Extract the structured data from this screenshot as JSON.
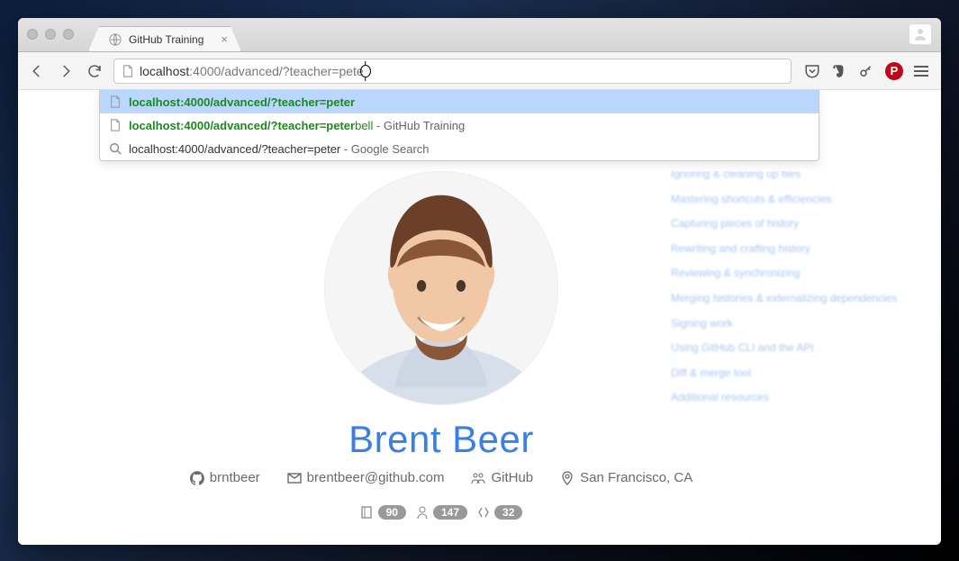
{
  "window": {
    "tab_title": "GitHub Training"
  },
  "toolbar": {
    "url_host": "localhost",
    "url_path": ":4000/advanced/?teacher=pete"
  },
  "suggestions": [
    {
      "icon": "page",
      "main": "localhost:4000/advanced/?teacher=peter",
      "suffix": "",
      "rest": ""
    },
    {
      "icon": "page",
      "main": "localhost:4000/advanced/?teacher=peter",
      "suffix": "bell",
      "rest": " - GitHub Training"
    },
    {
      "icon": "search",
      "main_plain": "localhost:4000/advanced/?teacher=peter",
      "rest": " - Google Search"
    }
  ],
  "profile": {
    "name": "Brent Beer",
    "username": "brntbeer",
    "email": "brentbeer@github.com",
    "org": "GitHub",
    "location": "San Francisco, CA"
  },
  "stats": {
    "repos": "90",
    "followers": "147",
    "gists": "32"
  },
  "sidebar_items": [
    "Ignoring & cleaning up files",
    "Mastering shortcuts & efficiencies",
    "Capturing pieces of history",
    "Rewriting and crafting history",
    "Reviewing & synchronizing",
    "Merging histories & externalizing dependencies",
    "Signing work",
    "Using GitHub CLI and the API",
    "Diff & merge tool",
    "Additional resources"
  ]
}
